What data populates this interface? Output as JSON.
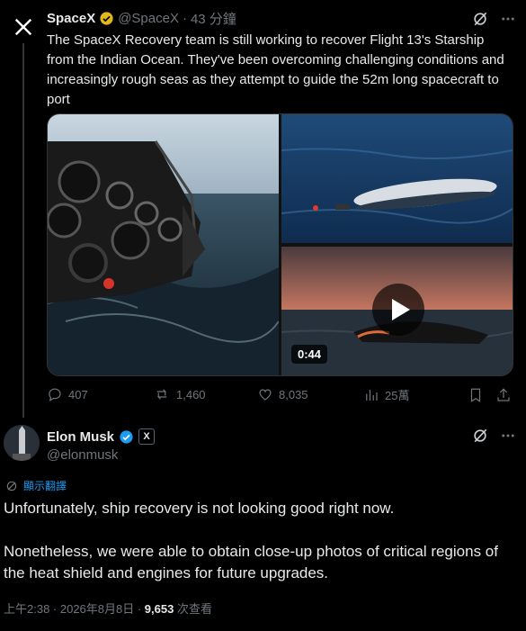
{
  "tweet1": {
    "author_name": "SpaceX",
    "handle": "@SpaceX",
    "time": "43 分鐘",
    "text": "The SpaceX Recovery team is still working to recover Flight 13's Starship from the Indian Ocean. They've been overcoming challenging conditions and increasingly rough seas as they attempt to guide the 52m long spacecraft to port",
    "video_duration": "0:44",
    "actions": {
      "replies": "407",
      "reposts": "1,460",
      "likes": "8,035",
      "views": "25萬"
    }
  },
  "tweet2": {
    "author_name": "Elon Musk",
    "handle": "@elonmusk",
    "affiliate_badge": "X",
    "translate_label": "顯示翻譯",
    "paragraph1": "Unfortunately, ship recovery is not looking good right now.",
    "paragraph2": "Nonetheless, we were able to obtain close-up photos of critical regions of the heat shield and engines for future upgrades.",
    "timestamp": "上午2:38 · 2026年8月8日 · ",
    "views_count": "9,653",
    "views_label": " 次查看"
  },
  "colors": {
    "accent": "#1d9bf0",
    "gold_badge": "#e2b719",
    "muted": "#71767b",
    "background": "#000000"
  },
  "icons": [
    "x-logo-icon",
    "gold-verified-icon",
    "grok-icon",
    "reply-icon",
    "repost-icon",
    "like-icon",
    "views-icon",
    "bookmark-icon",
    "share-icon",
    "play-icon",
    "blue-verified-icon",
    "globe-translate-icon"
  ]
}
